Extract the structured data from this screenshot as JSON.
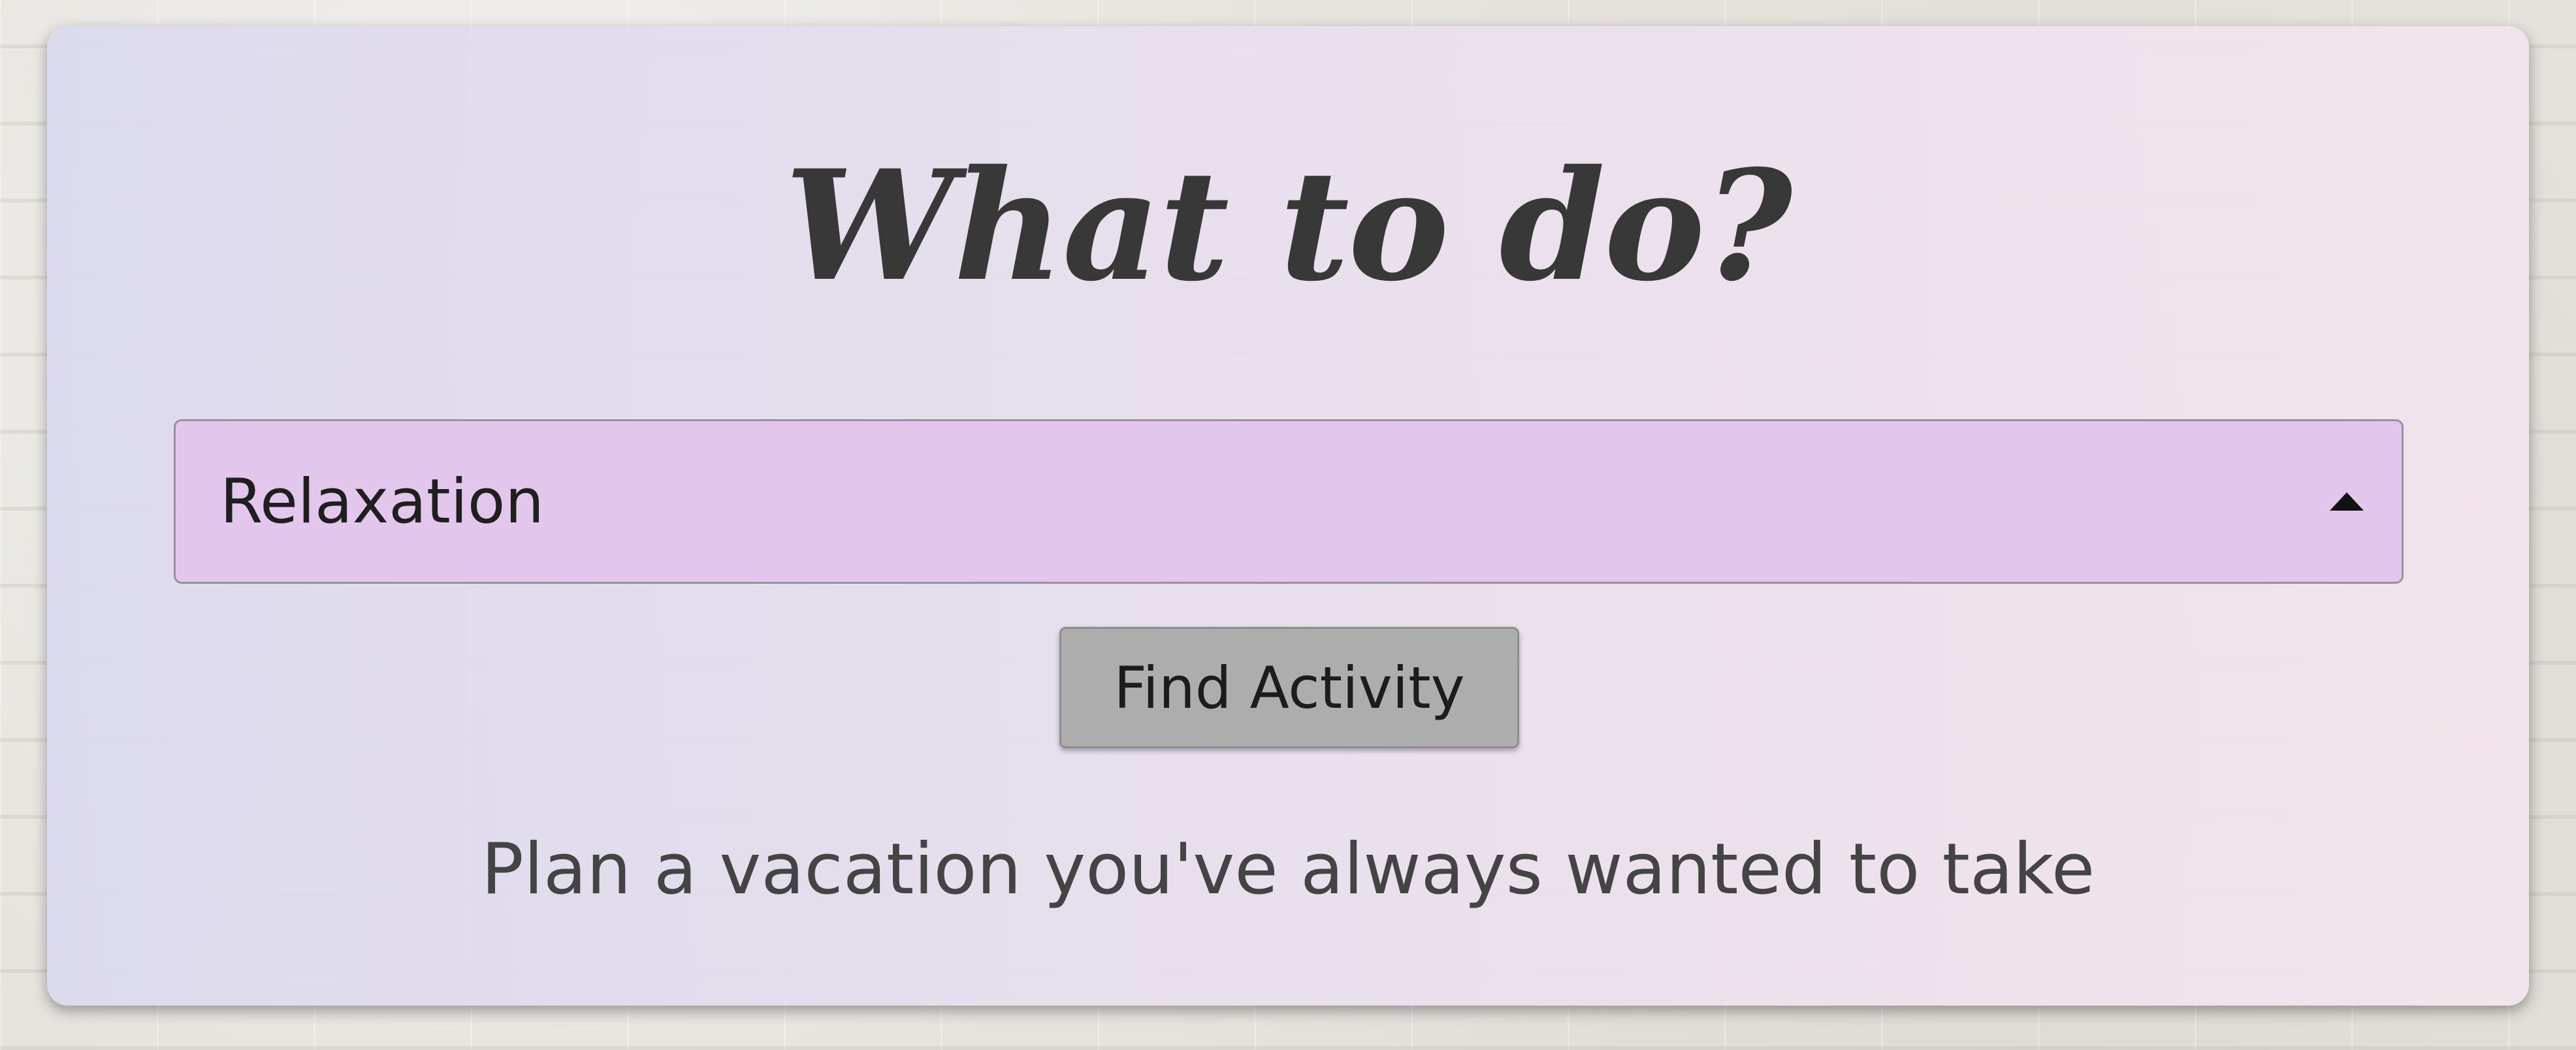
{
  "card": {
    "title": "What to do?"
  },
  "activity_select": {
    "selected_value": "Relaxation",
    "caret_icon": "caret-up-icon"
  },
  "find_button": {
    "label": "Find Activity"
  },
  "result": {
    "text": "Plan a vacation you've always wanted to take"
  },
  "colors": {
    "select_background": "#e2c6ec",
    "button_background": "#adadad",
    "title_color": "#383838"
  }
}
